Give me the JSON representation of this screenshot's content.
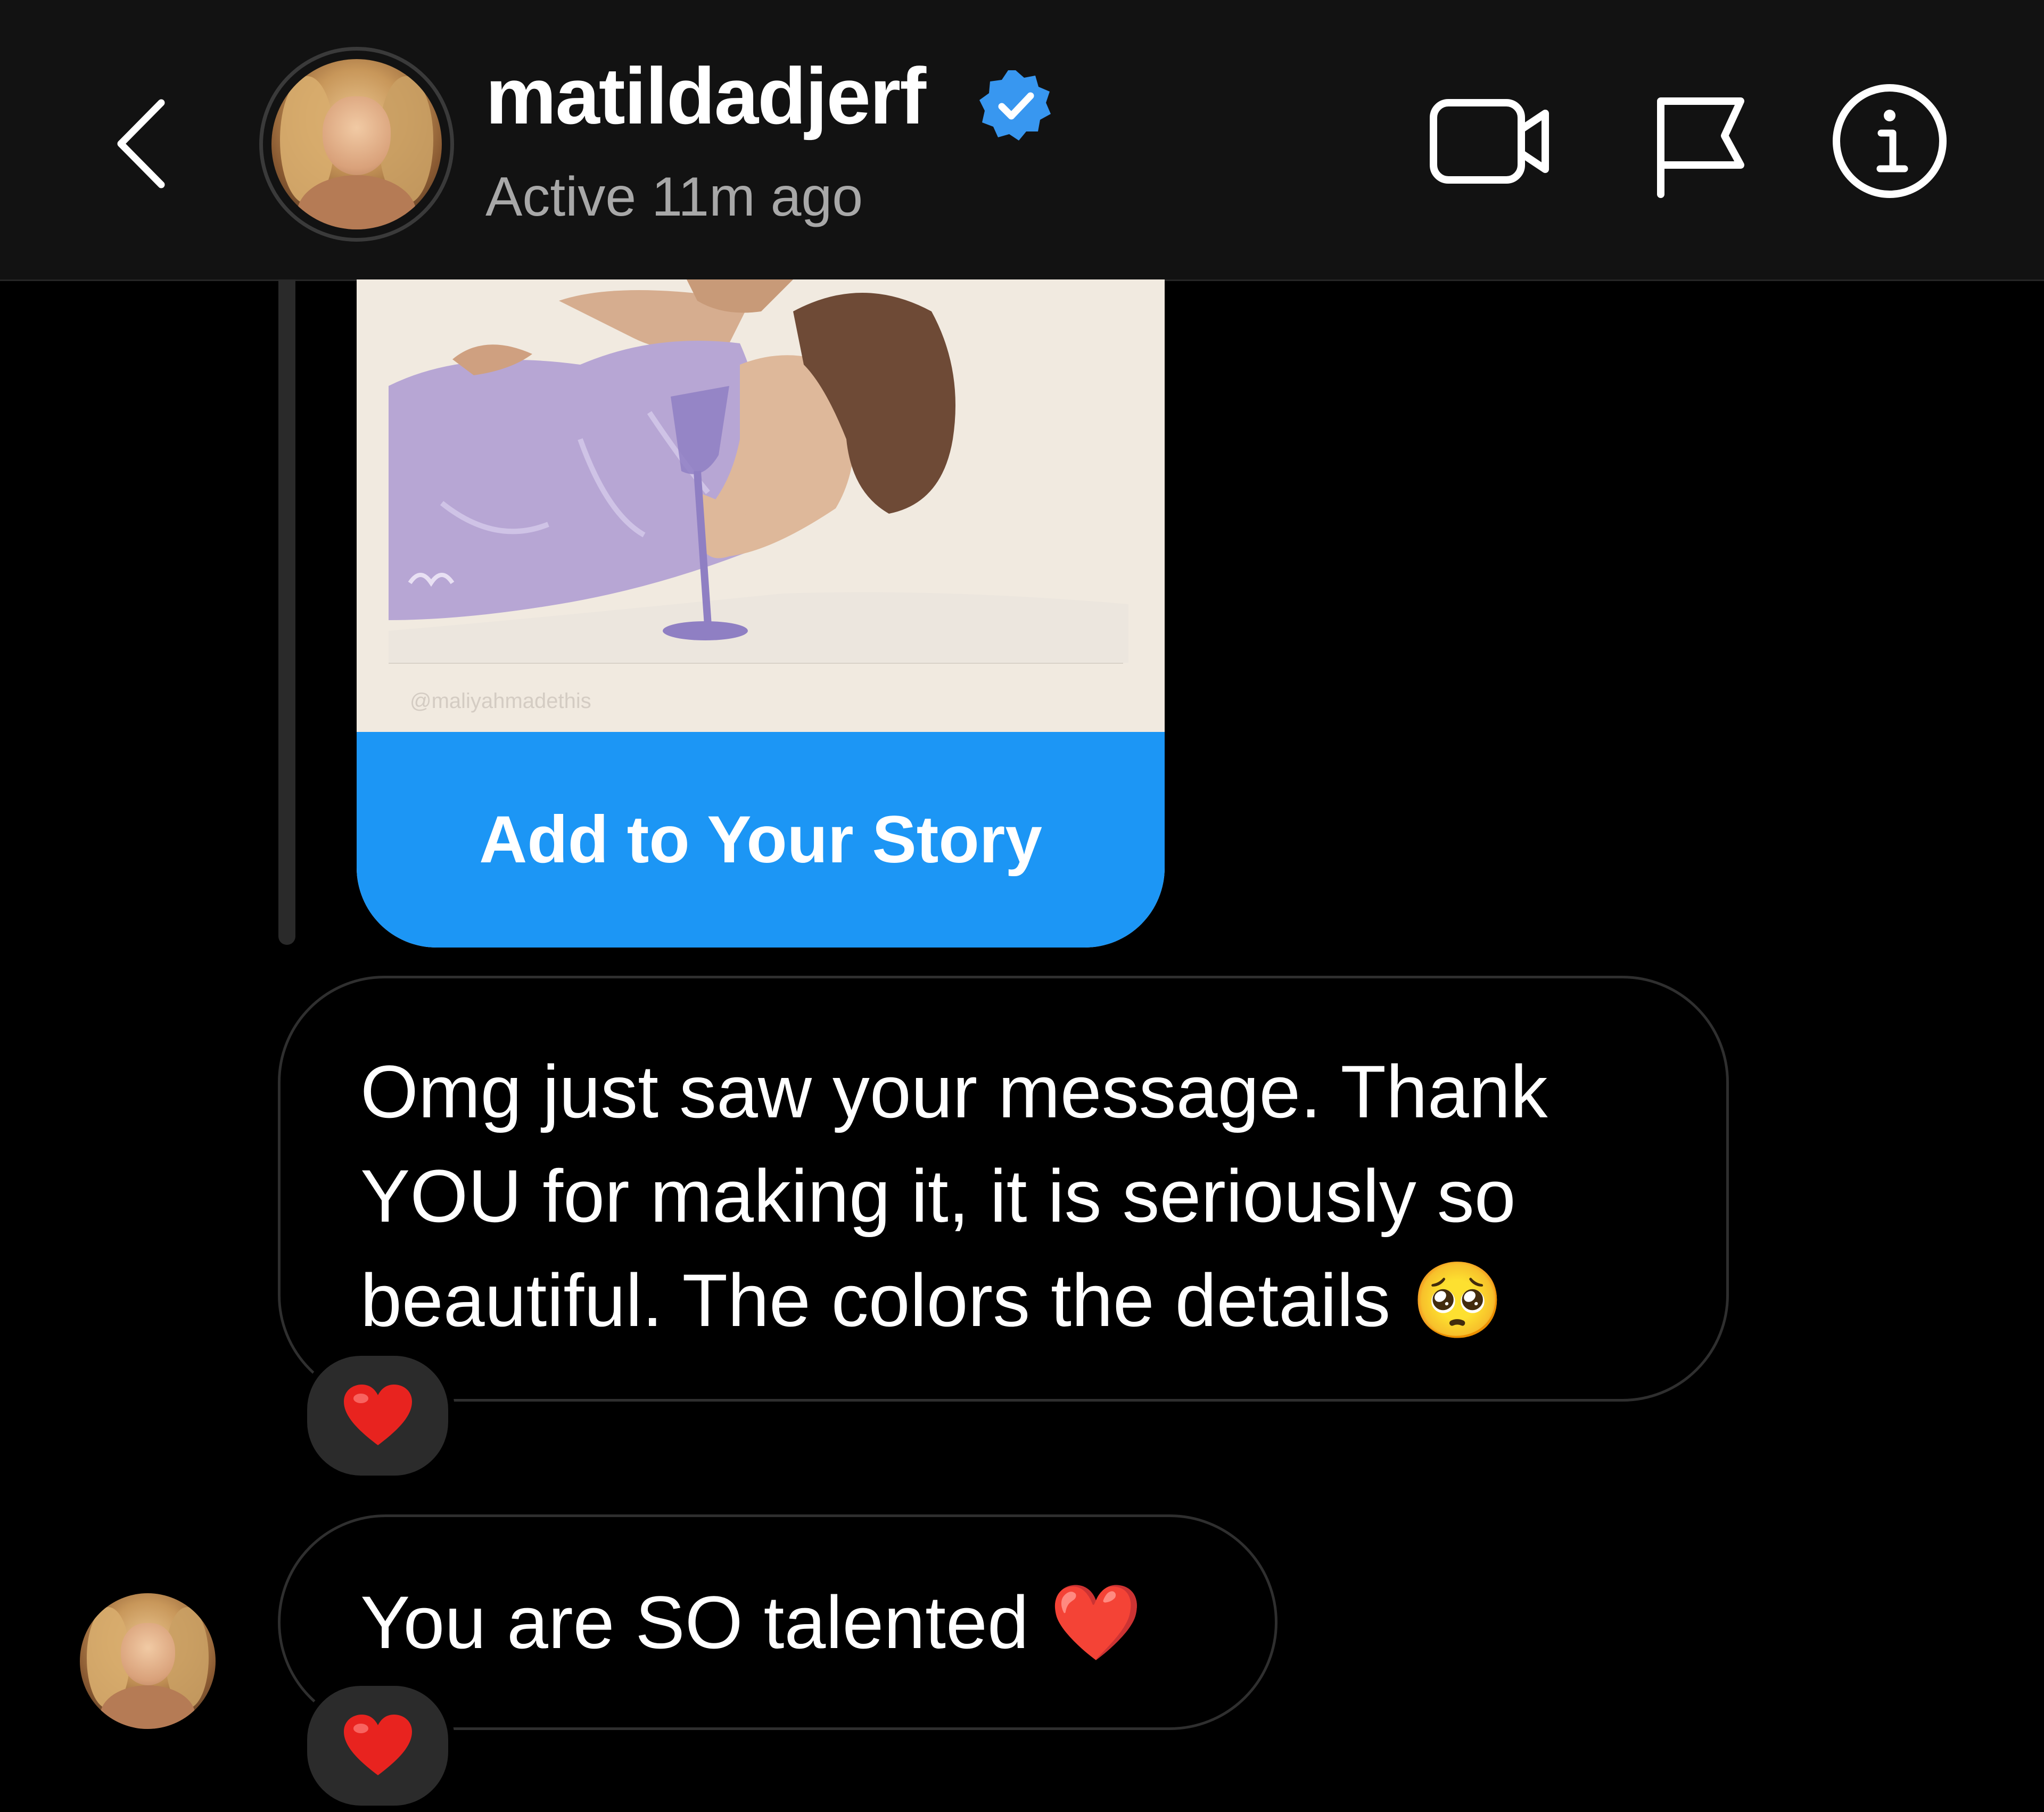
{
  "header": {
    "username": "matildadjerf",
    "status": "Active 11m ago",
    "icons": {
      "back": "chevron-left-icon",
      "verified": "verified-badge-icon",
      "video": "video-camera-icon",
      "report": "flag-icon",
      "info": "info-icon"
    }
  },
  "story_share": {
    "watermark": "@maliyahmadethis",
    "button_label": "Add to Your Story"
  },
  "messages": [
    {
      "text": "Omg just saw your message. Thank YOU for making it, it is seriously so beautiful. The colors the details 🥺",
      "reaction": "❤️"
    },
    {
      "text": "You are SO talented ❤️",
      "reaction": "❤️"
    }
  ],
  "colors": {
    "header_bg": "#121212",
    "background": "#000000",
    "accent_blue": "#1c96f5",
    "verified_blue": "#3897f0",
    "secondary_text": "#a8a8a8",
    "bubble_border": "#2f2f2f",
    "reaction_bg": "#2b2b2b"
  }
}
